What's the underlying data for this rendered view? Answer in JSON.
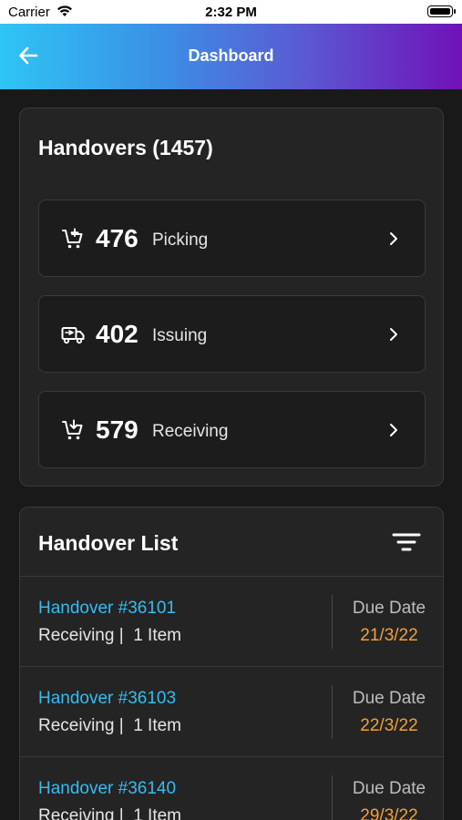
{
  "status_bar": {
    "carrier": "Carrier",
    "time": "2:32 PM"
  },
  "app_bar": {
    "title": "Dashboard",
    "back_icon": "arrow-left-icon"
  },
  "summary": {
    "title": "Handovers (1457)",
    "stats": [
      {
        "count": "476",
        "label": "Picking",
        "icon": "cart-plus-icon"
      },
      {
        "count": "402",
        "label": "Issuing",
        "icon": "truck-icon"
      },
      {
        "count": "579",
        "label": "Receiving",
        "icon": "cart-down-icon"
      }
    ]
  },
  "list": {
    "title": "Handover List",
    "filter_icon": "filter-icon",
    "items": [
      {
        "id": "Handover #36101",
        "sub": "Receiving |  1 Item",
        "due_label": "Due Date",
        "due_date": "21/3/22"
      },
      {
        "id": "Handover #36103",
        "sub": "Receiving |  1 Item",
        "due_label": "Due Date",
        "due_date": "22/3/22"
      },
      {
        "id": "Handover #36140",
        "sub": "Receiving |  1 Item",
        "due_label": "Due Date",
        "due_date": "29/3/22"
      }
    ]
  },
  "colors": {
    "accent_blue": "#33bdf2",
    "due_orange": "#f2a13b",
    "gradient_start": "#2ec5f5",
    "gradient_end": "#7011b8"
  }
}
